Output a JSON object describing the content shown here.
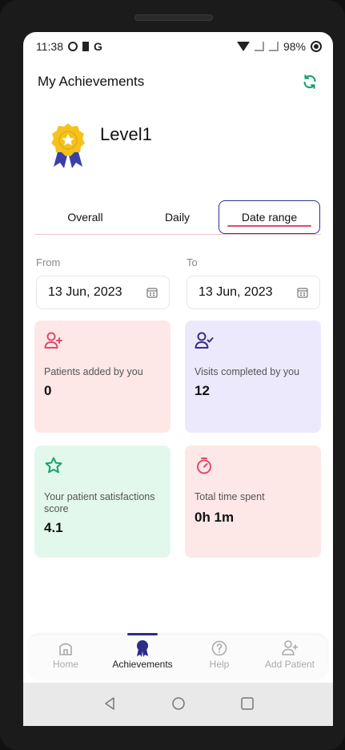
{
  "status_bar": {
    "time": "11:38",
    "g_label": "G",
    "battery_text": "98%"
  },
  "header": {
    "title": "My Achievements"
  },
  "level": {
    "text": "Level1"
  },
  "tabs": {
    "overall": "Overall",
    "daily": "Daily",
    "date_range": "Date range",
    "active": "Date range"
  },
  "date_filter": {
    "from_label": "From",
    "to_label": "To",
    "from_value": "13 Jun, 2023",
    "to_value": "13 Jun, 2023"
  },
  "cards": [
    {
      "label": "Patients added by you",
      "value": "0",
      "icon": "person-add-icon",
      "color": "#fde7e7",
      "icon_color": "#e04a6c"
    },
    {
      "label": "Visits completed by you",
      "value": "12",
      "icon": "person-check-icon",
      "color": "#ece9fd",
      "icon_color": "#3b2e86"
    },
    {
      "label": "Your patient satisfactions score",
      "value": "4.1",
      "icon": "star-icon",
      "color": "#e3f8ec",
      "icon_color": "#1aa36b"
    },
    {
      "label": "Total time spent",
      "value": "0h 1m",
      "icon": "stopwatch-icon",
      "color": "#fde7e7",
      "icon_color": "#e04a6c"
    }
  ],
  "bottom_nav": {
    "home": "Home",
    "achievements": "Achievements",
    "help": "Help",
    "add_patient": "Add Patient",
    "active": "Achievements"
  },
  "colors": {
    "accent": "#e04a6c",
    "brand": "#2c2c8a",
    "refresh": "#1aa36b"
  }
}
